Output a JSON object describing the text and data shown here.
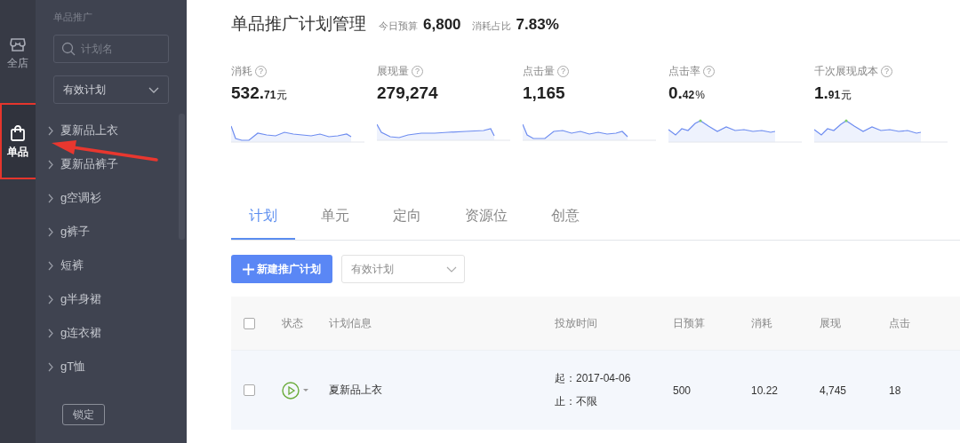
{
  "rail": [
    {
      "label": "全店",
      "kind": "store",
      "selected": false,
      "highlighted": false
    },
    {
      "label": "单品",
      "kind": "bag",
      "selected": true,
      "highlighted": true
    }
  ],
  "sidebar": {
    "heading": "单品推广",
    "search": {
      "placeholder": "计划名"
    },
    "filter": {
      "value": "有效计划"
    },
    "plans": [
      {
        "label": "夏新品上衣"
      },
      {
        "label": "夏新品裤子"
      },
      {
        "label": "g空调衫"
      },
      {
        "label": "g裤子"
      },
      {
        "label": "短裤"
      },
      {
        "label": "g半身裙"
      },
      {
        "label": "g连衣裙"
      },
      {
        "label": "gT恤"
      }
    ],
    "lock_button": "锁定"
  },
  "header": {
    "title": "单品推广计划管理",
    "budget_label": "今日预算",
    "budget_value": "6,800",
    "share_label": "消耗占比",
    "share_value": "7.83%"
  },
  "metrics": [
    {
      "label": "消耗",
      "help": "?",
      "integer": "532.",
      "fraction": "71",
      "unit": "元"
    },
    {
      "label": "展现量",
      "help": "?",
      "integer": "279,274"
    },
    {
      "label": "点击量",
      "help": "?",
      "integer": "1,165"
    },
    {
      "label": "点击率",
      "help": "?",
      "integer": "0.",
      "fraction": "42",
      "unit": "%"
    },
    {
      "label": "千次展现成本",
      "help": "?",
      "integer": "1.",
      "fraction": "91",
      "unit": "元"
    }
  ],
  "tabs": [
    {
      "label": "计划",
      "selected": true
    },
    {
      "label": "单元",
      "selected": false
    },
    {
      "label": "定向",
      "selected": false
    },
    {
      "label": "资源位",
      "selected": false
    },
    {
      "label": "创意",
      "selected": false
    }
  ],
  "toolbar": {
    "new_button": "新建推广计划",
    "filter": {
      "value": "有效计划"
    }
  },
  "table": {
    "header_checked": false,
    "columns": [
      "状态",
      "计划信息",
      "投放时间",
      "日预算",
      "消耗",
      "展现",
      "点击"
    ],
    "rows": [
      {
        "checked": false,
        "status": {
          "kind": "running"
        },
        "name": "夏新品上衣",
        "start": "起：2017-04-06",
        "end": "止：不限",
        "budget": "500",
        "spend": "10.22",
        "impressions": "4,745",
        "clicks": "18"
      }
    ]
  }
}
